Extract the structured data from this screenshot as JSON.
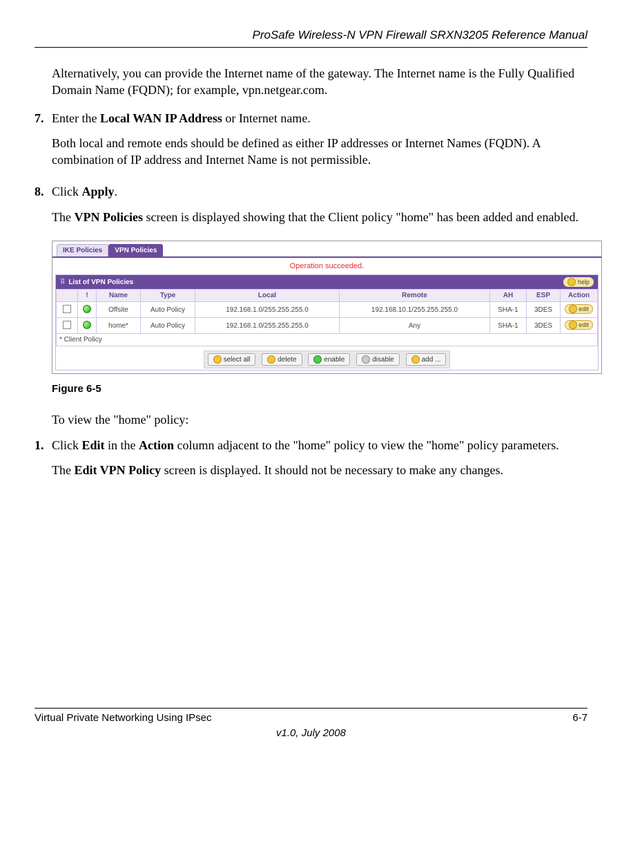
{
  "header": {
    "title": "ProSafe Wireless-N VPN Firewall SRXN3205 Reference Manual"
  },
  "intro": "Alternatively, you can provide the Internet name of the gateway. The Internet name is the Fully Qualified Domain Name (FQDN); for example, vpn.netgear.com.",
  "step7": {
    "num": "7.",
    "line1a": "Enter the ",
    "line1b": "Local WAN IP Address",
    "line1c": " or Internet name.",
    "line2": "Both local and remote ends should be defined as either IP addresses or Internet Names (FQDN). A combination of IP address and Internet Name is not permissible."
  },
  "step8": {
    "num": "8.",
    "line1a": "Click ",
    "line1b": "Apply",
    "line1c": ".",
    "line2a": "The ",
    "line2b": "VPN Policies",
    "line2c": " screen is displayed showing that the Client policy \"home\" has been added and enabled."
  },
  "figure": {
    "caption": "Figure 6-5",
    "tabs": {
      "ike": "IKE Policies",
      "vpn": "VPN Policies"
    },
    "status": "Operation succeeded.",
    "panel_title": "List of VPN Policies",
    "help": "help",
    "headers": {
      "bang": "!",
      "name": "Name",
      "type": "Type",
      "local": "Local",
      "remote": "Remote",
      "ah": "AH",
      "esp": "ESP",
      "action": "Action"
    },
    "rows": [
      {
        "name": "Offsite",
        "type": "Auto Policy",
        "local": "192.168.1.0/255.255.255.0",
        "remote": "192.168.10.1/255.255.255.0",
        "ah": "SHA-1",
        "esp": "3DES",
        "edit": "edit"
      },
      {
        "name": "home*",
        "type": "Auto Policy",
        "local": "192.168.1.0/255.255.255.0",
        "remote": "Any",
        "ah": "SHA-1",
        "esp": "3DES",
        "edit": "edit"
      }
    ],
    "footnote": "* Client Policy",
    "buttons": {
      "selectall": "select all",
      "delete": "delete",
      "enable": "enable",
      "disable": "disable",
      "add": "add ..."
    }
  },
  "afterfig": "To view the \"home\" policy:",
  "step1b": {
    "num": "1.",
    "line1a": "Click ",
    "line1b": "Edit",
    "line1c": " in the ",
    "line1d": "Action",
    "line1e": " column adjacent to the \"home\" policy to view the \"home\" policy parameters.",
    "line2a": "The ",
    "line2b": "Edit VPN Policy",
    "line2c": " screen is displayed. It should not be necessary to make any changes."
  },
  "footer": {
    "left": "Virtual Private Networking Using IPsec",
    "right": "6-7",
    "version": "v1.0, July 2008"
  }
}
